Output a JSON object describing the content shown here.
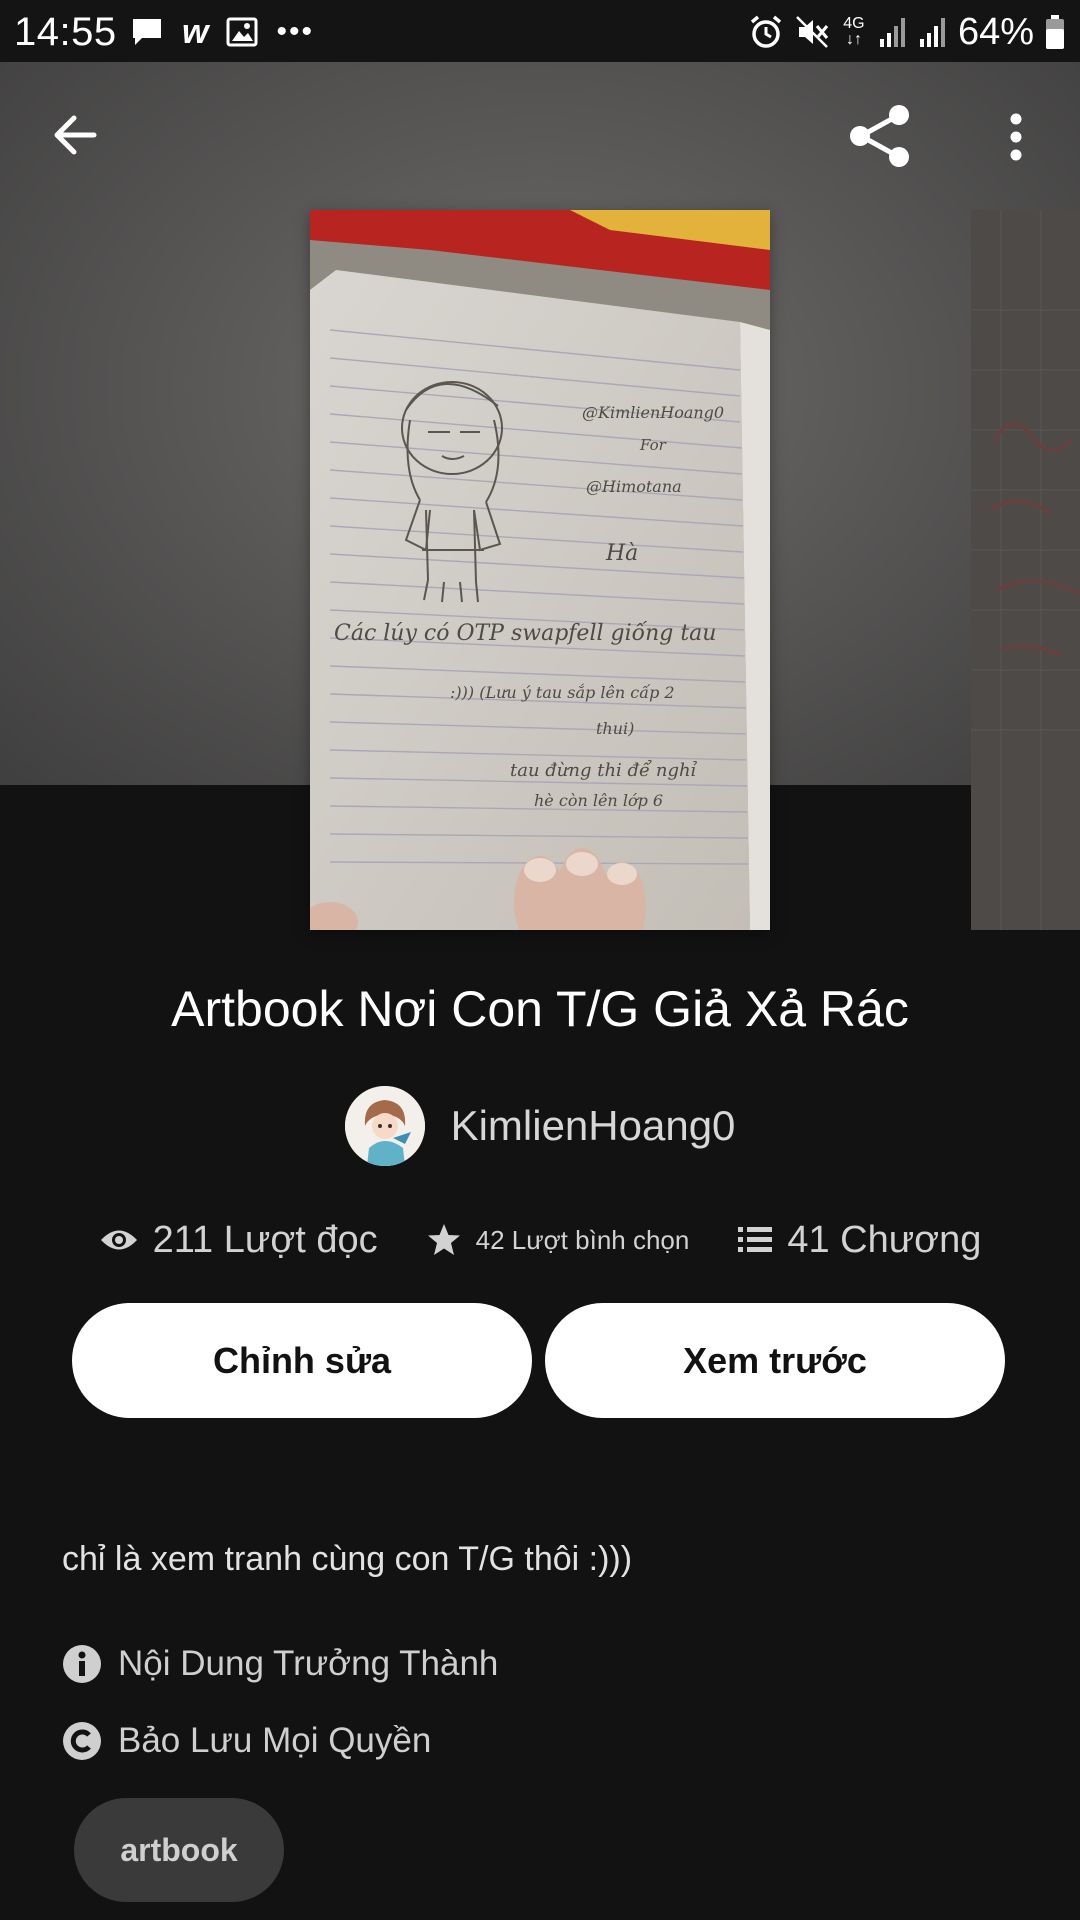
{
  "status_bar": {
    "time": "14:55",
    "left_icons": [
      "message-icon",
      "wattpad-w-icon",
      "gallery-icon",
      "more-dots-icon"
    ],
    "network": "4G",
    "battery": "64%"
  },
  "toolbar": {
    "back_icon": "arrow-left-icon",
    "share_icon": "share-icon",
    "more_icon": "more-vertical-icon"
  },
  "story": {
    "title": "Artbook Nơi Con T/G Giả Xả Rác",
    "author": "KimlienHoang0",
    "stats": {
      "reads": "211 Lượt đọc",
      "votes": "42 Lượt bình chọn",
      "parts": "41 Chương"
    },
    "description": "chỉ là xem tranh cùng con T/G thôi :)))",
    "rating": "Nội Dung Trưởng Thành",
    "copyright": "Bảo Lưu Mọi Quyền",
    "tags": [
      "artbook"
    ]
  },
  "cover_sketch": {
    "handle": "@KimlienHoang0",
    "for_label": "For",
    "recipient": "@Himotana",
    "signature": "Hà",
    "note_lines": [
      "Các lúy có OTP swapfell giống tau",
      ":))) (Lưu ý tau sắp lên cấp 2",
      "thui)",
      "tau đừng thi để nghỉ",
      "hè còn lên lớp 6"
    ]
  },
  "actions": {
    "edit_label": "Chỉnh sửa",
    "preview_label": "Xem trước"
  },
  "colors": {
    "background": "#121212",
    "header": "#5b5a59",
    "button": "#ffffff",
    "chip": "#3a3a3a"
  }
}
